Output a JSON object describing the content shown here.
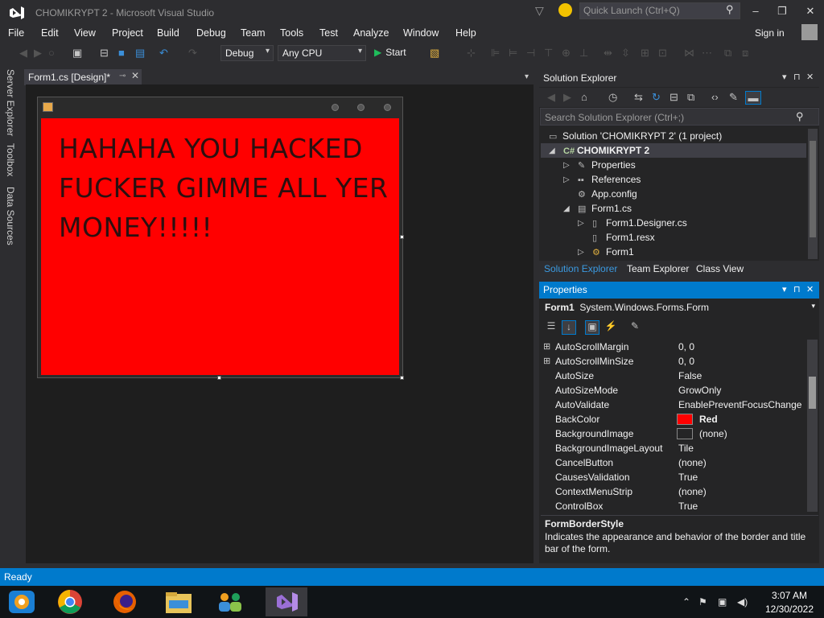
{
  "window": {
    "title": "CHOMIKRYPT 2 - Microsoft Visual Studio",
    "quick_launch_placeholder": "Quick Launch (Ctrl+Q)",
    "controls": {
      "minimize": "–",
      "maximize": "❐",
      "close": "✕"
    }
  },
  "menu": {
    "items": [
      "File",
      "Edit",
      "View",
      "Project",
      "Build",
      "Debug",
      "Team",
      "Tools",
      "Test",
      "Analyze",
      "Window",
      "Help"
    ],
    "signin": "Sign in"
  },
  "toolbar": {
    "config": "Debug",
    "platform": "Any CPU",
    "start_label": "Start"
  },
  "side_tabs": [
    "Server Explorer",
    "Toolbox",
    "Data Sources"
  ],
  "document_tab": {
    "label": "Form1.cs [Design]*"
  },
  "form": {
    "label_text": "HAHAHA YOU HACKED FUCKER GIMME ALL YER MONEY!!!!!",
    "backcolor": "#ff0000"
  },
  "solution_explorer": {
    "title": "Solution Explorer",
    "search_placeholder": "Search Solution Explorer (Ctrl+;)",
    "tree": [
      {
        "label": "Solution 'CHOMIKRYPT 2' (1 project)",
        "icon": "solution-icon"
      },
      {
        "label": "CHOMIKRYPT 2",
        "icon": "csharp-project-icon"
      },
      {
        "label": "Properties",
        "icon": "wrench-icon"
      },
      {
        "label": "References",
        "icon": "references-icon"
      },
      {
        "label": "App.config",
        "icon": "config-icon"
      },
      {
        "label": "Form1.cs",
        "icon": "form-icon"
      },
      {
        "label": "Form1.Designer.cs",
        "icon": "cs-file-icon"
      },
      {
        "label": "Form1.resx",
        "icon": "resx-icon"
      },
      {
        "label": "Form1",
        "icon": "class-icon"
      }
    ],
    "tabs": [
      "Solution Explorer",
      "Team Explorer",
      "Class View"
    ]
  },
  "properties": {
    "title": "Properties",
    "object_name": "Form1",
    "object_type": "System.Windows.Forms.Form",
    "rows": [
      {
        "name": "AutoScrollMargin",
        "value": "0, 0",
        "expandable": true
      },
      {
        "name": "AutoScrollMinSize",
        "value": "0, 0",
        "expandable": true
      },
      {
        "name": "AutoSize",
        "value": "False"
      },
      {
        "name": "AutoSizeMode",
        "value": "GrowOnly"
      },
      {
        "name": "AutoValidate",
        "value": "EnablePreventFocusChange"
      },
      {
        "name": "BackColor",
        "value": "Red",
        "swatch": "#ff0000"
      },
      {
        "name": "BackgroundImage",
        "value": "(none)",
        "swatch": "#252526"
      },
      {
        "name": "BackgroundImageLayout",
        "value": "Tile"
      },
      {
        "name": "CancelButton",
        "value": "(none)"
      },
      {
        "name": "CausesValidation",
        "value": "True"
      },
      {
        "name": "ContextMenuStrip",
        "value": "(none)"
      },
      {
        "name": "ControlBox",
        "value": "True"
      }
    ],
    "description_title": "FormBorderStyle",
    "description_text": "Indicates the appearance and behavior of the border and title bar of the form."
  },
  "status": {
    "text": "Ready"
  },
  "taskbar": {
    "apps": [
      "windows-media-icon",
      "chrome-icon",
      "firefox-icon",
      "file-explorer-icon",
      "people-icon",
      "visual-studio-icon"
    ],
    "time": "3:07 AM",
    "date": "12/30/2022"
  },
  "colors": {
    "accent": "#007acc",
    "statusbar": "#007acc",
    "form_back": "#ff0000"
  }
}
